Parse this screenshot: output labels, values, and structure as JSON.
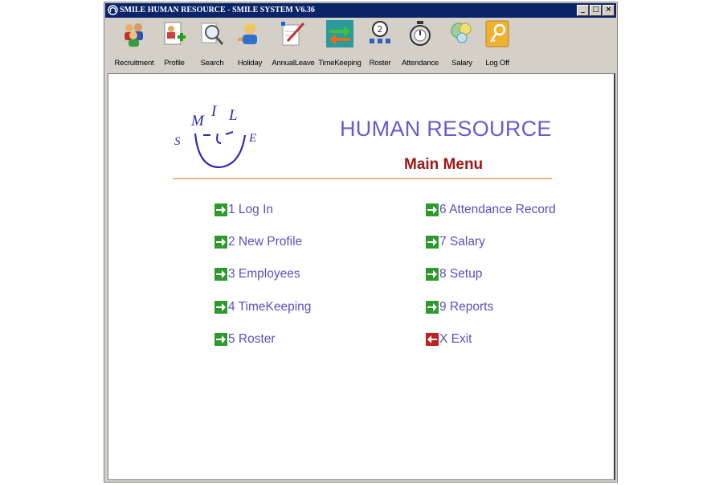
{
  "window": {
    "title": "SMILE HUMAN RESOURCE - SMILE SYSTEM V6.36",
    "controls": {
      "minimize": "_",
      "maximize": "□",
      "close": "×"
    }
  },
  "toolbar": {
    "items": [
      {
        "label": "Recruitment",
        "icon": "people-group-icon"
      },
      {
        "label": "Profile",
        "icon": "profile-add-icon"
      },
      {
        "label": "Search",
        "icon": "magnifier-icon"
      },
      {
        "label": "Holiday",
        "icon": "holiday-person-icon"
      },
      {
        "label": "AnnualLeave",
        "icon": "annual-leave-pen-icon"
      },
      {
        "label": "TimeKeeping",
        "icon": "timekeeping-arrows-icon"
      },
      {
        "label": "Roster",
        "icon": "roster-clock-icon"
      },
      {
        "label": "Attendance",
        "icon": "attendance-stopwatch-icon"
      },
      {
        "label": "Salary",
        "icon": "salary-coins-icon"
      },
      {
        "label": "Log Off",
        "icon": "log-off-key-icon"
      }
    ]
  },
  "header": {
    "logo_letters": {
      "s": "S",
      "m": "M",
      "i": "I",
      "l": "L",
      "e": "E"
    },
    "title": "HUMAN RESOURCE",
    "subtitle": "Main Menu"
  },
  "menu": {
    "left": [
      {
        "label": "1 Log In",
        "icon": "green-arrow-icon"
      },
      {
        "label": "2 New Profile",
        "icon": "green-arrow-icon"
      },
      {
        "label": "3 Employees",
        "icon": "green-arrow-icon"
      },
      {
        "label": "4 TimeKeeping",
        "icon": "green-arrow-icon"
      },
      {
        "label": "5 Roster",
        "icon": "green-arrow-icon"
      }
    ],
    "right": [
      {
        "label": "6 Attendance Record",
        "icon": "green-arrow-icon"
      },
      {
        "label": "7 Salary",
        "icon": "green-arrow-icon"
      },
      {
        "label": "8 Setup",
        "icon": "green-arrow-icon"
      },
      {
        "label": "9 Reports",
        "icon": "green-arrow-icon"
      },
      {
        "label": "X Exit",
        "icon": "red-exit-arrow-icon"
      }
    ]
  },
  "colors": {
    "title_bar": "#0a246a",
    "heading": "#6a5acd",
    "subtitle": "#a01818",
    "menu_text": "#5a50c0",
    "divider": "#e8b887",
    "go_arrow": "#2e9a2e",
    "exit_arrow": "#c02020"
  }
}
